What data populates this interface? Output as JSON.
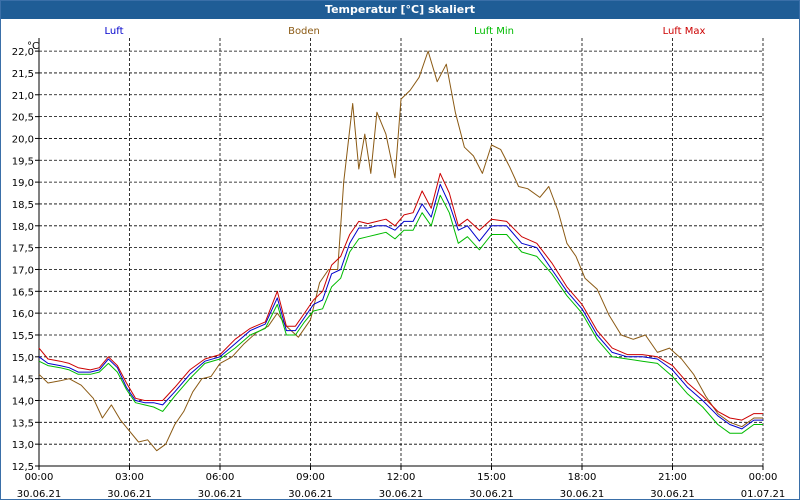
{
  "window": {
    "title": "Temperatur [°C] skaliert"
  },
  "colors": {
    "luft": "#0000cc",
    "boden": "#8b5a14",
    "luft_min": "#00bb00",
    "luft_max": "#cc0000",
    "titlebar": "#1f5d96"
  },
  "chart_data": {
    "type": "line",
    "title": "Temperatur [°C] skaliert",
    "ylabel": "°C",
    "ylim": [
      12.5,
      22.3
    ],
    "yticks": [
      "12,5",
      "13,0",
      "13,5",
      "14,0",
      "14,5",
      "15,0",
      "15,5",
      "16,0",
      "16,5",
      "17,0",
      "17,5",
      "18,0",
      "18,5",
      "19,0",
      "19,5",
      "20,0",
      "20,5",
      "21,0",
      "21,5",
      "22,0"
    ],
    "xlim": [
      0,
      24
    ],
    "xticks": [
      {
        "time": "00:00",
        "date": "30.06.21"
      },
      {
        "time": "03:00",
        "date": "30.06.21"
      },
      {
        "time": "06:00",
        "date": "30.06.21"
      },
      {
        "time": "09:00",
        "date": "30.06.21"
      },
      {
        "time": "12:00",
        "date": "30.06.21"
      },
      {
        "time": "15:00",
        "date": "30.06.21"
      },
      {
        "time": "18:00",
        "date": "30.06.21"
      },
      {
        "time": "21:00",
        "date": "30.06.21"
      },
      {
        "time": "00:00",
        "date": "01.07.21"
      }
    ],
    "grid": true,
    "legend_position": "top",
    "series": [
      {
        "name": "Luft",
        "color": "#0000cc",
        "x": [
          0,
          0.3,
          0.7,
          1.0,
          1.3,
          1.7,
          2.0,
          2.3,
          2.6,
          2.9,
          3.2,
          3.5,
          3.8,
          4.1,
          4.5,
          5.0,
          5.5,
          6.0,
          6.5,
          7.0,
          7.5,
          7.9,
          8.2,
          8.5,
          8.8,
          9.1,
          9.4,
          9.7,
          10.0,
          10.3,
          10.6,
          10.9,
          11.2,
          11.5,
          11.8,
          12.1,
          12.4,
          12.7,
          13.0,
          13.3,
          13.6,
          13.9,
          14.2,
          14.6,
          15.0,
          15.5,
          16.0,
          16.5,
          17.0,
          17.5,
          18.0,
          18.5,
          19.0,
          19.5,
          20.0,
          20.5,
          21.0,
          21.5,
          22.0,
          22.5,
          22.9,
          23.3,
          23.7,
          24.0
        ],
        "y": [
          15.0,
          14.85,
          14.8,
          14.75,
          14.65,
          14.65,
          14.7,
          14.95,
          14.75,
          14.3,
          14.0,
          13.95,
          13.95,
          13.9,
          14.2,
          14.6,
          14.9,
          15.0,
          15.3,
          15.6,
          15.75,
          16.35,
          15.6,
          15.6,
          15.9,
          16.2,
          16.3,
          16.9,
          17.0,
          17.6,
          17.95,
          17.95,
          18.0,
          18.0,
          17.9,
          18.1,
          18.1,
          18.5,
          18.2,
          18.95,
          18.5,
          17.9,
          18.0,
          17.65,
          18.0,
          18.0,
          17.6,
          17.5,
          17.0,
          16.5,
          16.1,
          15.5,
          15.1,
          15.0,
          15.0,
          14.95,
          14.7,
          14.3,
          14.0,
          13.65,
          13.45,
          13.35,
          13.55,
          13.55
        ]
      },
      {
        "name": "Boden",
        "color": "#8b5a14",
        "x": [
          0,
          0.3,
          0.7,
          1.0,
          1.4,
          1.8,
          2.1,
          2.4,
          2.7,
          3.0,
          3.3,
          3.6,
          3.9,
          4.2,
          4.5,
          4.8,
          5.1,
          5.4,
          5.7,
          6.0,
          6.4,
          6.8,
          7.2,
          7.6,
          7.9,
          8.2,
          8.6,
          9.0,
          9.3,
          9.6,
          9.9,
          10.1,
          10.4,
          10.6,
          10.8,
          11.0,
          11.2,
          11.5,
          11.8,
          12.0,
          12.3,
          12.6,
          12.9,
          13.2,
          13.5,
          13.8,
          14.1,
          14.4,
          14.7,
          15.0,
          15.3,
          15.6,
          15.9,
          16.2,
          16.6,
          16.9,
          17.2,
          17.5,
          17.8,
          18.1,
          18.5,
          18.9,
          19.3,
          19.7,
          20.1,
          20.5,
          20.9,
          21.3,
          21.7,
          22.1,
          22.5,
          22.9,
          23.3,
          23.7,
          24.0
        ],
        "y": [
          14.6,
          14.4,
          14.45,
          14.5,
          14.35,
          14.05,
          13.6,
          13.9,
          13.55,
          13.3,
          13.05,
          13.1,
          12.85,
          13.0,
          13.45,
          13.75,
          14.2,
          14.5,
          14.55,
          14.85,
          15.0,
          15.3,
          15.55,
          15.7,
          16.0,
          15.7,
          15.45,
          15.85,
          16.7,
          17.0,
          17.0,
          19.0,
          20.8,
          19.3,
          20.1,
          19.2,
          20.6,
          20.1,
          19.1,
          20.9,
          21.1,
          21.4,
          22.0,
          21.3,
          21.7,
          20.6,
          19.8,
          19.6,
          19.2,
          19.85,
          19.75,
          19.35,
          18.9,
          18.85,
          18.65,
          18.9,
          18.35,
          17.6,
          17.3,
          16.8,
          16.55,
          15.95,
          15.5,
          15.4,
          15.5,
          15.1,
          15.2,
          14.95,
          14.6,
          14.1,
          13.7,
          13.5,
          13.4,
          13.6,
          13.6
        ]
      },
      {
        "name": "Luft Min",
        "color": "#00bb00",
        "x": [
          0,
          0.3,
          0.7,
          1.0,
          1.3,
          1.7,
          2.0,
          2.3,
          2.6,
          2.9,
          3.2,
          3.5,
          3.8,
          4.1,
          4.5,
          5.0,
          5.5,
          6.0,
          6.5,
          7.0,
          7.5,
          7.9,
          8.2,
          8.5,
          8.8,
          9.1,
          9.4,
          9.7,
          10.0,
          10.3,
          10.6,
          10.9,
          11.2,
          11.5,
          11.8,
          12.1,
          12.4,
          12.7,
          13.0,
          13.3,
          13.6,
          13.9,
          14.2,
          14.6,
          15.0,
          15.5,
          16.0,
          16.5,
          17.0,
          17.5,
          18.0,
          18.5,
          19.0,
          19.5,
          20.0,
          20.5,
          21.0,
          21.5,
          22.0,
          22.5,
          22.9,
          23.3,
          23.7,
          24.0
        ],
        "y": [
          14.9,
          14.8,
          14.75,
          14.7,
          14.6,
          14.6,
          14.65,
          14.85,
          14.65,
          14.25,
          13.95,
          13.9,
          13.85,
          13.75,
          14.1,
          14.5,
          14.85,
          14.95,
          15.2,
          15.5,
          15.65,
          16.2,
          15.5,
          15.5,
          15.8,
          16.05,
          16.1,
          16.6,
          16.8,
          17.4,
          17.7,
          17.75,
          17.8,
          17.85,
          17.7,
          17.9,
          17.9,
          18.3,
          18.0,
          18.7,
          18.3,
          17.6,
          17.75,
          17.45,
          17.8,
          17.8,
          17.4,
          17.3,
          16.9,
          16.4,
          16.0,
          15.4,
          15.0,
          14.95,
          14.9,
          14.85,
          14.55,
          14.15,
          13.85,
          13.45,
          13.25,
          13.25,
          13.45,
          13.45
        ]
      },
      {
        "name": "Luft Max",
        "color": "#cc0000",
        "x": [
          0,
          0.3,
          0.7,
          1.0,
          1.3,
          1.7,
          2.0,
          2.3,
          2.6,
          2.9,
          3.2,
          3.5,
          3.8,
          4.1,
          4.5,
          5.0,
          5.5,
          6.0,
          6.5,
          7.0,
          7.5,
          7.9,
          8.2,
          8.5,
          8.8,
          9.1,
          9.4,
          9.7,
          10.0,
          10.3,
          10.6,
          10.9,
          11.2,
          11.5,
          11.8,
          12.1,
          12.4,
          12.7,
          13.0,
          13.3,
          13.6,
          13.9,
          14.2,
          14.6,
          15.0,
          15.5,
          16.0,
          16.5,
          17.0,
          17.5,
          18.0,
          18.5,
          19.0,
          19.5,
          20.0,
          20.5,
          21.0,
          21.5,
          22.0,
          22.5,
          22.9,
          23.3,
          23.7,
          24.0
        ],
        "y": [
          15.2,
          14.95,
          14.9,
          14.85,
          14.75,
          14.7,
          14.75,
          15.0,
          14.8,
          14.4,
          14.05,
          14.0,
          14.0,
          14.0,
          14.3,
          14.7,
          14.95,
          15.05,
          15.4,
          15.65,
          15.8,
          16.5,
          15.7,
          15.7,
          16.0,
          16.3,
          16.5,
          17.1,
          17.3,
          17.8,
          18.1,
          18.05,
          18.1,
          18.15,
          18.0,
          18.25,
          18.3,
          18.8,
          18.4,
          19.2,
          18.75,
          18.0,
          18.15,
          17.9,
          18.15,
          18.1,
          17.75,
          17.6,
          17.15,
          16.6,
          16.2,
          15.6,
          15.2,
          15.05,
          15.05,
          15.0,
          14.8,
          14.4,
          14.1,
          13.75,
          13.6,
          13.55,
          13.7,
          13.7
        ]
      }
    ]
  }
}
